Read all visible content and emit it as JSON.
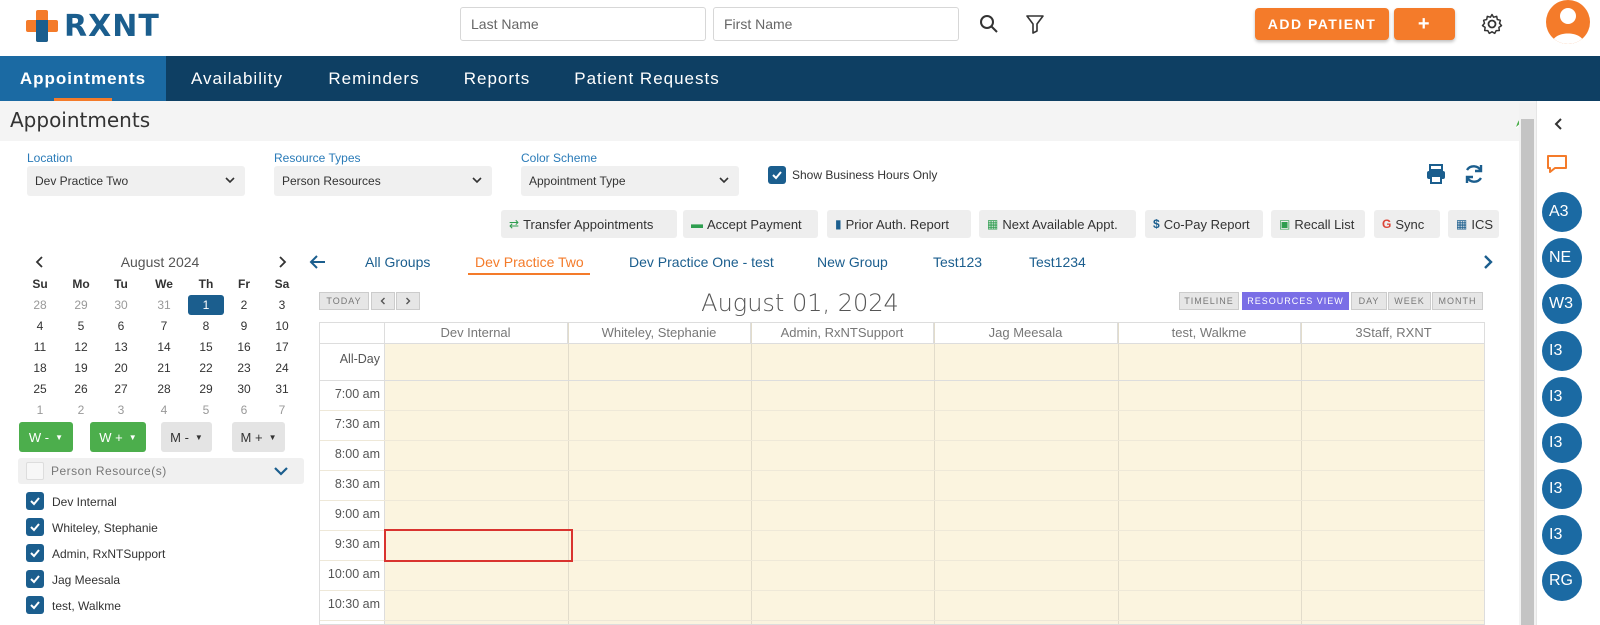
{
  "header": {
    "logo_text": "RXNT",
    "last_name_placeholder": "Last Name",
    "first_name_placeholder": "First Name",
    "add_patient_label": "ADD PATIENT",
    "plus_label": "+"
  },
  "nav": {
    "items": [
      {
        "label": "Appointments",
        "active": true
      },
      {
        "label": "Availability"
      },
      {
        "label": "Reminders"
      },
      {
        "label": "Reports"
      },
      {
        "label": "Patient Requests"
      }
    ]
  },
  "page": {
    "title": "Appointments"
  },
  "filters": {
    "location_label": "Location",
    "location_value": "Dev Practice Two",
    "resource_types_label": "Resource Types",
    "resource_types_value": "Person Resources",
    "color_scheme_label": "Color Scheme",
    "color_scheme_value": "Appointment Type",
    "business_hours_label": "Show Business Hours Only",
    "business_hours_checked": true
  },
  "actions": [
    {
      "label": "Transfer Appointments",
      "icon": "transfer-icon"
    },
    {
      "label": "Accept Payment",
      "icon": "money-icon"
    },
    {
      "label": "Prior Auth. Report",
      "icon": "book-icon"
    },
    {
      "label": "Next Available Appt.",
      "icon": "calendar-icon"
    },
    {
      "label": "Co-Pay Report",
      "icon": "dollar-icon"
    },
    {
      "label": "Recall List",
      "icon": "recall-icon"
    },
    {
      "label": "Sync",
      "icon": "google-icon"
    },
    {
      "label": "ICS",
      "icon": "calendar-icon"
    }
  ],
  "mini_calendar": {
    "month": "August 2024",
    "dow": [
      "Su",
      "Mo",
      "Tu",
      "We",
      "Th",
      "Fr",
      "Sa"
    ],
    "weeks": [
      [
        "28",
        "29",
        "30",
        "31",
        "1",
        "2",
        "3"
      ],
      [
        "4",
        "5",
        "6",
        "7",
        "8",
        "9",
        "10"
      ],
      [
        "11",
        "12",
        "13",
        "14",
        "15",
        "16",
        "17"
      ],
      [
        "18",
        "19",
        "20",
        "21",
        "22",
        "23",
        "24"
      ],
      [
        "25",
        "26",
        "27",
        "28",
        "29",
        "30",
        "31"
      ],
      [
        "1",
        "2",
        "3",
        "4",
        "5",
        "6",
        "7"
      ]
    ],
    "selected_day": "1"
  },
  "week_buttons": [
    "W -",
    "W +",
    "M -",
    "M +"
  ],
  "resources": {
    "header": "Person Resource(s)",
    "items": [
      "Dev Internal",
      "Whiteley, Stephanie",
      "Admin, RxNTSupport",
      "Jag Meesala",
      "test, Walkme"
    ]
  },
  "groups": {
    "tabs": [
      "All Groups",
      "Dev Practice Two",
      "Dev Practice One - test",
      "New Group",
      "Test123",
      "Test1234"
    ],
    "active": "Dev Practice Two"
  },
  "calendar": {
    "today_label": "TODAY",
    "date_title": "August 01, 2024",
    "views": [
      "TIMELINE",
      "RESOURCES VIEW",
      "DAY",
      "WEEK",
      "MONTH"
    ],
    "active_view": "RESOURCES VIEW",
    "columns": [
      "Dev Internal",
      "Whiteley, Stephanie",
      "Admin, RxNTSupport",
      "Jag Meesala",
      "test, Walkme",
      "3Staff, RXNT"
    ],
    "all_day_label": "All-Day",
    "times": [
      "7:00 am",
      "7:30 am",
      "8:00 am",
      "8:30 am",
      "9:00 am",
      "9:30 am",
      "10:00 am",
      "10:30 am"
    ]
  },
  "side_chips": [
    "A3",
    "NE",
    "W3",
    "I3",
    "I3",
    "I3",
    "I3",
    "I3",
    "RG"
  ],
  "colors": {
    "brand_orange": "#f47b2a",
    "brand_blue": "#1b5e8e",
    "nav_bg": "#0e3f63",
    "grid_bg": "#fbf4df"
  }
}
